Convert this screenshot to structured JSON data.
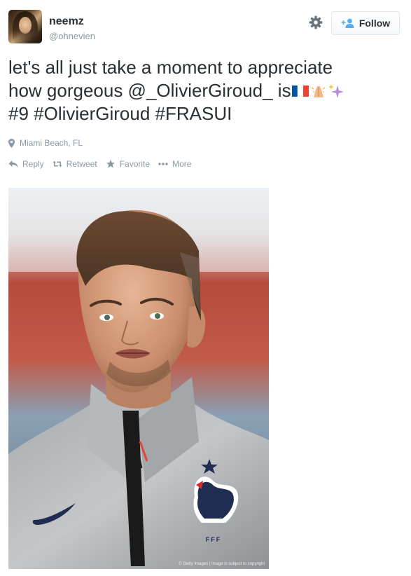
{
  "user": {
    "name": "neemz",
    "handle": "@ohnevien"
  },
  "follow": {
    "label": "Follow"
  },
  "tweet": {
    "line1": "let's all just take a moment to appreciate",
    "line2_text": "how gorgeous @_OlivierGiroud_ is",
    "line3": "#9 #OlivierGiroud #FRASUI"
  },
  "location": "Miami Beach, FL",
  "actions": {
    "reply": "Reply",
    "retweet": "Retweet",
    "favorite": "Favorite",
    "more": "More"
  },
  "photo": {
    "credit": "© Getty Images | Image is subject to copyright"
  },
  "colors": {
    "text": "#292f33",
    "muted": "#8899a6",
    "border": "#e1e8ed",
    "link": "#55acee"
  }
}
